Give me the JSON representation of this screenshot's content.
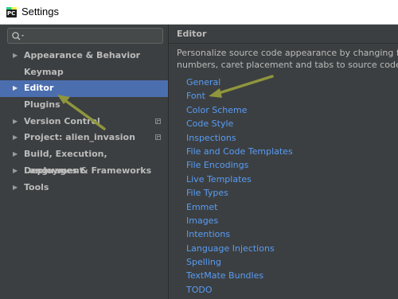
{
  "window": {
    "title": "Settings",
    "icon": "pycharm-app-icon",
    "icon_text": "PC"
  },
  "search": {
    "placeholder": "",
    "value": ""
  },
  "sidebar": {
    "items": [
      {
        "label": "Appearance & Behavior",
        "expandable": true,
        "selected": false
      },
      {
        "label": "Keymap",
        "expandable": false,
        "selected": false
      },
      {
        "label": "Editor",
        "expandable": true,
        "selected": true
      },
      {
        "label": "Plugins",
        "expandable": false,
        "selected": false
      },
      {
        "label": "Version Control",
        "expandable": true,
        "selected": false,
        "badge": "project-scope-icon"
      },
      {
        "label": "Project: alien_invasion",
        "expandable": true,
        "selected": false,
        "badge": "project-scope-icon"
      },
      {
        "label": "Build, Execution, Deployment",
        "expandable": true,
        "selected": false
      },
      {
        "label": "Languages & Frameworks",
        "expandable": true,
        "selected": false
      },
      {
        "label": "Tools",
        "expandable": true,
        "selected": false
      }
    ]
  },
  "main": {
    "title": "Editor",
    "description_line1": "Personalize source code appearance by changing fonts, hi",
    "description_line2": "numbers, caret placement and tabs to source code inspec",
    "links": [
      "General",
      "Font",
      "Color Scheme",
      "Code Style",
      "Inspections",
      "File and Code Templates",
      "File Encodings",
      "Live Templates",
      "File Types",
      "Emmet",
      "Images",
      "Intentions",
      "Language Injections",
      "Spelling",
      "TextMate Bundles",
      "TODO"
    ]
  },
  "colors": {
    "background": "#3c3f41",
    "selection": "#4b6eaf",
    "link": "#589df6",
    "annotation_arrow": "#8f963c"
  }
}
